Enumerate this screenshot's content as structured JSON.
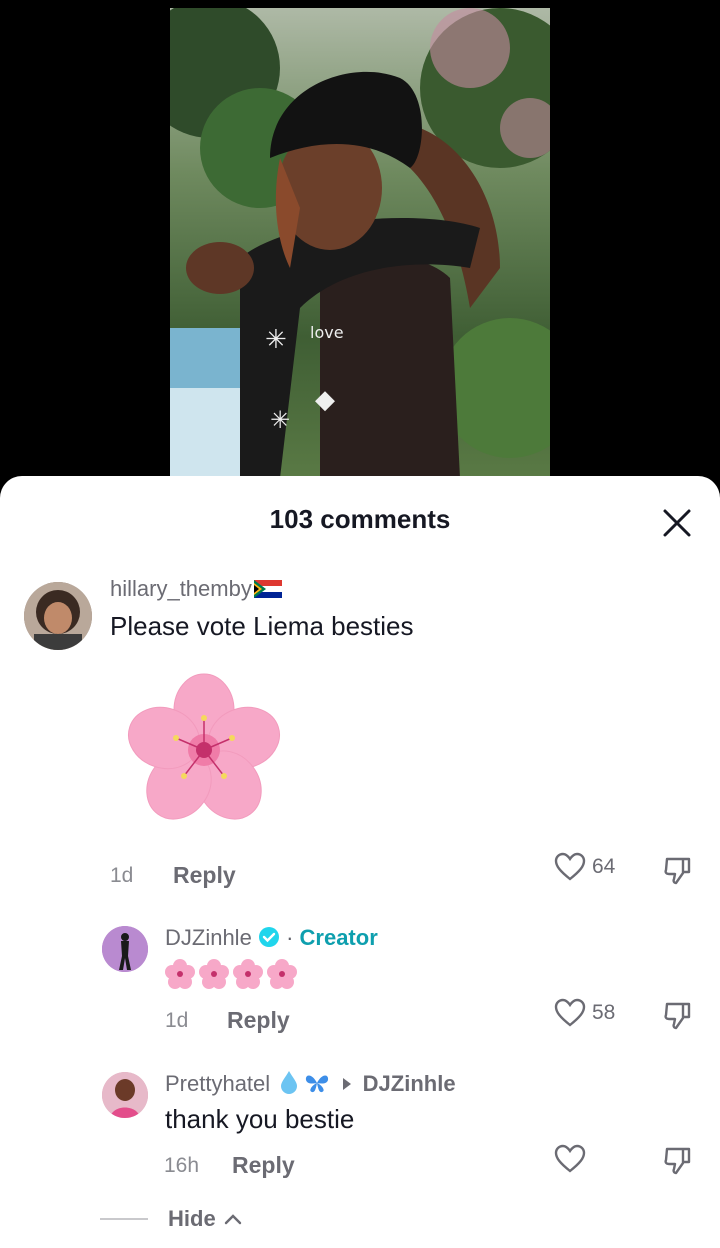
{
  "header": {
    "comments_title": "103 comments"
  },
  "icons": {
    "close": "close-icon",
    "heart": "heart-outline-icon",
    "dislike": "thumbs-down-icon",
    "verified": "verified-badge-icon",
    "flag": "south-africa-flag-icon",
    "flower": "cherry-blossom-icon",
    "caret": "caret-right-icon",
    "chevron": "chevron-up-icon"
  },
  "colors": {
    "creator": "#0e9fae",
    "verified": "#20d5ec",
    "blossom": "#f7a8c8"
  },
  "comments": [
    {
      "username": "hillary_themby",
      "text": "Please vote Liema besties",
      "time": "1d",
      "reply_label": "Reply",
      "likes": "64"
    },
    {
      "username": "DJZinhle",
      "separator": "·",
      "creator_label": "Creator",
      "time": "1d",
      "reply_label": "Reply",
      "likes": "58"
    },
    {
      "username": "Prettyhatel",
      "reply_to": "DJZinhle",
      "text": "thank you bestie",
      "time": "16h",
      "reply_label": "Reply"
    }
  ],
  "replies_toggle": {
    "label": "Hide"
  }
}
